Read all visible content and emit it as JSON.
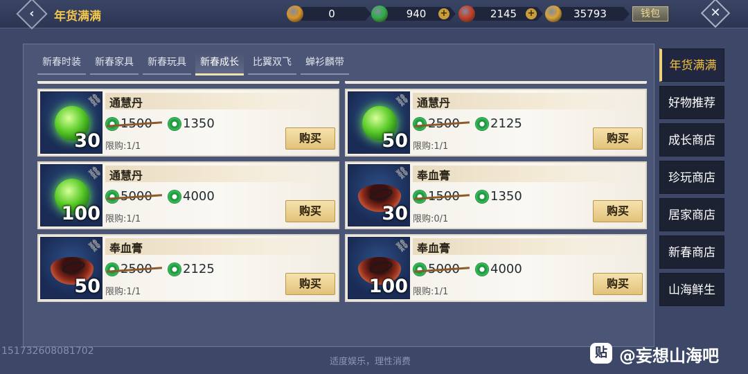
{
  "header": {
    "title": "年货满满",
    "back_icon": "‹",
    "close_icon": "✕",
    "wallet_label": "钱包",
    "currencies": [
      {
        "name": "coin-pouch",
        "value": "0",
        "color": "#d8962c",
        "plus": false
      },
      {
        "name": "jade-coin",
        "value": "940",
        "color": "#2fb04a",
        "plus": true
      },
      {
        "name": "red-token",
        "value": "2145",
        "color": "#c4402a",
        "plus": true
      },
      {
        "name": "gold-ingot",
        "value": "35793",
        "color": "#d9a33a",
        "plus": false
      }
    ]
  },
  "tabs": [
    {
      "label": "新春时装"
    },
    {
      "label": "新春家具"
    },
    {
      "label": "新春玩具"
    },
    {
      "label": "新春成长",
      "active": true
    },
    {
      "label": "比翼双飞"
    },
    {
      "label": "蝉衫麟带"
    }
  ],
  "items": [
    {
      "name": "通慧丹",
      "qty": "30",
      "icon": "green-pill-icon",
      "old_price": "1500",
      "price": "1350",
      "limit": "限购:1/1",
      "buy": "购买"
    },
    {
      "name": "通慧丹",
      "qty": "50",
      "icon": "green-pill-icon",
      "old_price": "2500",
      "price": "2125",
      "limit": "限购:1/1",
      "buy": "购买"
    },
    {
      "name": "通慧丹",
      "qty": "100",
      "icon": "green-pill-icon",
      "old_price": "5000",
      "price": "4000",
      "limit": "限购:1/1",
      "buy": "购买"
    },
    {
      "name": "奉血膏",
      "qty": "30",
      "icon": "blood-bowl-icon",
      "old_price": "1500",
      "price": "1350",
      "limit": "限购:0/1",
      "buy": "购买"
    },
    {
      "name": "奉血膏",
      "qty": "50",
      "icon": "blood-bowl-icon",
      "old_price": "2500",
      "price": "2125",
      "limit": "限购:1/1",
      "buy": "购买"
    },
    {
      "name": "奉血膏",
      "qty": "100",
      "icon": "blood-bowl-icon",
      "old_price": "5000",
      "price": "4000",
      "limit": "限购:1/1",
      "buy": "购买"
    }
  ],
  "side_nav": [
    {
      "label": "年货满满",
      "active": true
    },
    {
      "label": "好物推荐"
    },
    {
      "label": "成长商店"
    },
    {
      "label": "珍玩商店"
    },
    {
      "label": "居家商店"
    },
    {
      "label": "新春商店"
    },
    {
      "label": "山海鲜生"
    }
  ],
  "footer": {
    "uid": "151732608081702",
    "notice": "适度娱乐，理性消费"
  },
  "watermark": {
    "logo": "贴",
    "text": "@妄想山海吧"
  }
}
